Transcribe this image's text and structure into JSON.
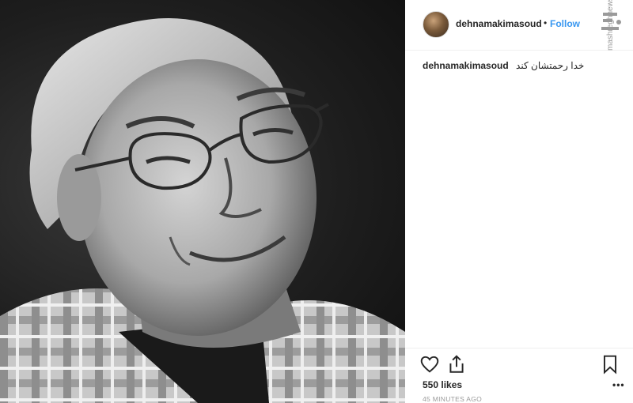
{
  "post": {
    "username": "dehnamakimasoud",
    "separator": "•",
    "follow_label": "Follow",
    "caption_username": "dehnamakimasoud",
    "caption_text": "خدا رحمتشان کند",
    "likes": "550 likes",
    "time": "45 MINUTES AGO",
    "more": "•••"
  },
  "watermark": {
    "logo": "مشرق",
    "url": "mashreghnews.ir"
  },
  "icons": {
    "like": "heart-icon",
    "share": "share-icon",
    "save": "bookmark-icon"
  },
  "colors": {
    "follow": "#3897f0",
    "text": "#262626",
    "muted": "#999999"
  }
}
